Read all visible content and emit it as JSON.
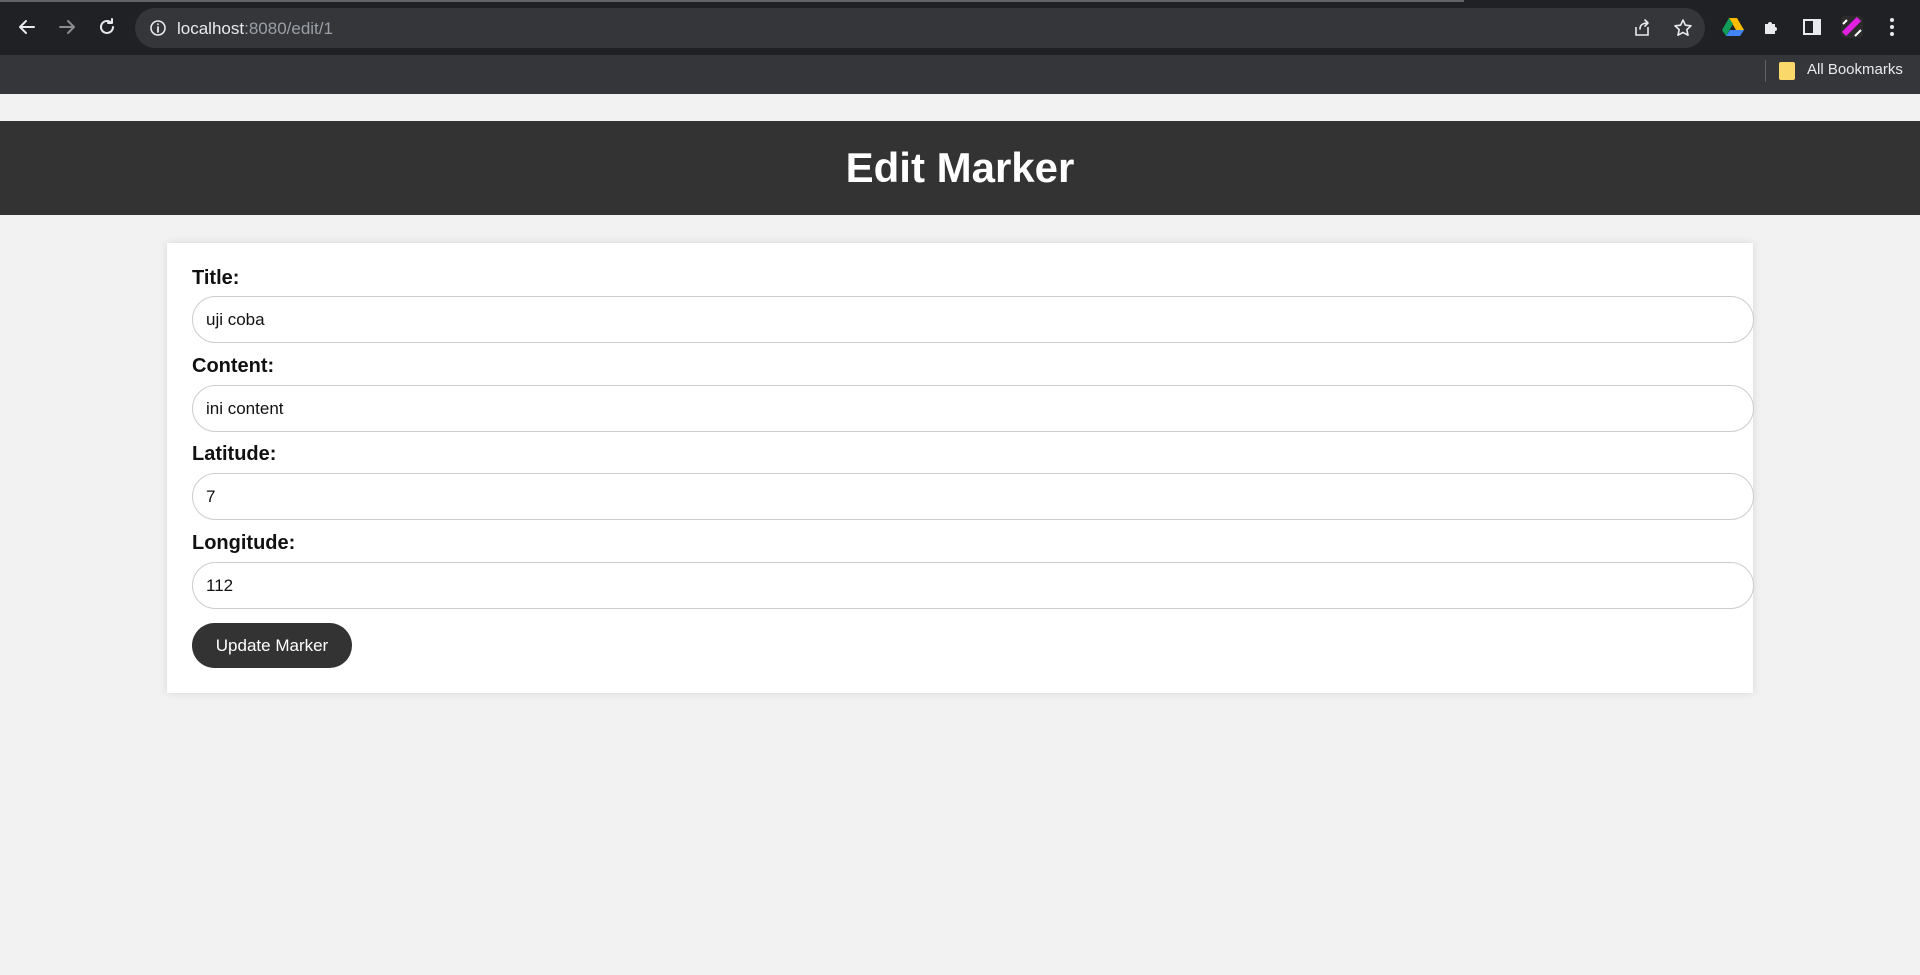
{
  "browser": {
    "url_host": "localhost",
    "url_path": ":8080/edit/1",
    "bookmarks_label": "All Bookmarks"
  },
  "page": {
    "title": "Edit Marker"
  },
  "form": {
    "title_label": "Title:",
    "title_value": "uji coba",
    "content_label": "Content:",
    "content_value": "ini content",
    "latitude_label": "Latitude:",
    "latitude_value": "7",
    "longitude_label": "Longitude:",
    "longitude_value": "112",
    "submit_label": "Update Marker"
  },
  "colors": {
    "header_bg": "#333333",
    "button_bg": "#333333",
    "page_bg": "#f2f2f2"
  }
}
